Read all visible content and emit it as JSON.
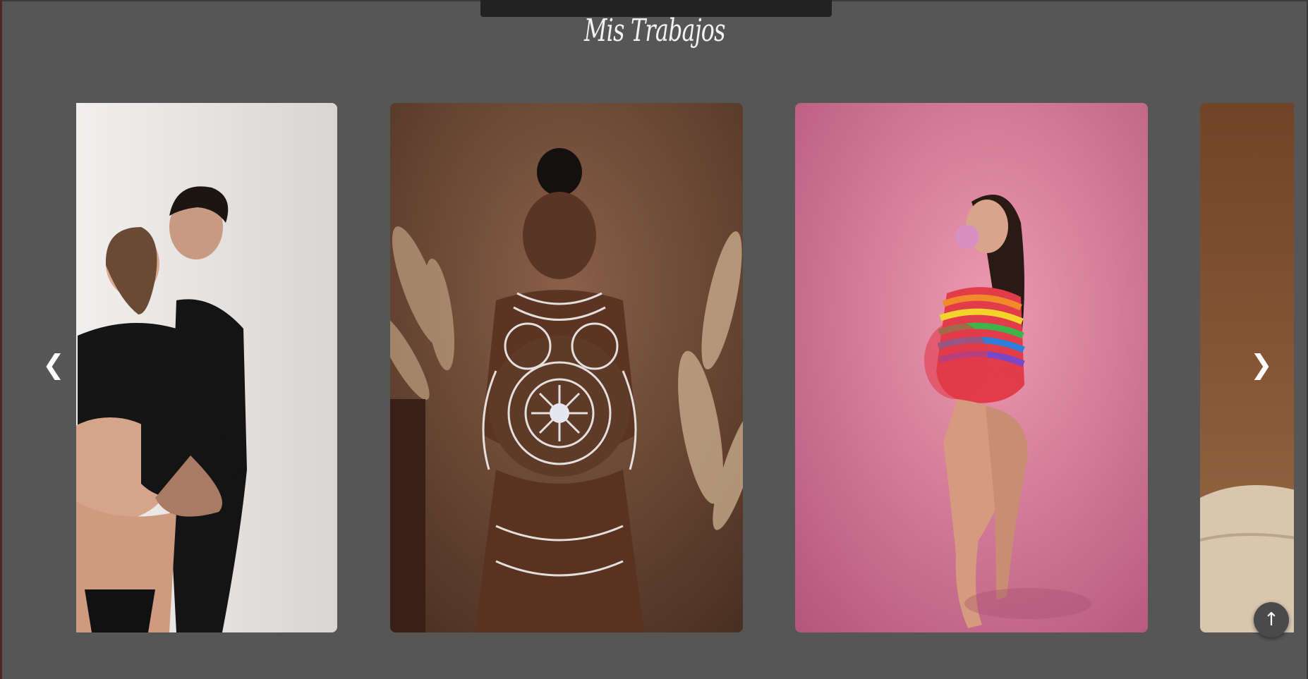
{
  "section": {
    "title": "Mis Trabajos"
  },
  "carousel": {
    "prev_label": "❮",
    "next_label": "❯",
    "slides": [
      {
        "subject": "couple-maternity-white-backdrop"
      },
      {
        "subject": "body-paint-maternity-brown-backdrop"
      },
      {
        "subject": "rainbow-mesh-maternity-pink-backdrop"
      },
      {
        "subject": "partial-slide-beige-bed"
      }
    ]
  },
  "back_to_top": {
    "label": "↑"
  },
  "colors": {
    "page_background": "#565656",
    "slide_1_background": "#e6e3e1",
    "slide_2_background": "#6b4733",
    "slide_3_background": "#e48aa5",
    "slide_4_background": "#7a5030",
    "nav_color": "#ffffff",
    "title_color": "#f2f2f2"
  }
}
